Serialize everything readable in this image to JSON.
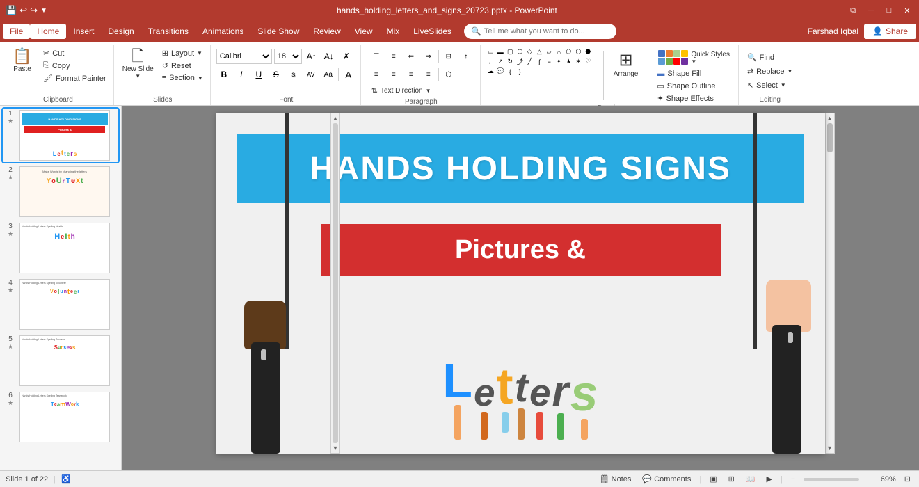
{
  "titlebar": {
    "title": "hands_holding_letters_and_signs_20723.pptx - PowerPoint",
    "quickaccess": [
      "💾",
      "↩",
      "↪",
      "📋",
      "▼"
    ]
  },
  "menubar": {
    "items": [
      "File",
      "Home",
      "Insert",
      "Design",
      "Transitions",
      "Animations",
      "Slide Show",
      "Review",
      "View",
      "Mix",
      "LiveSlides"
    ],
    "active": "Home",
    "search_placeholder": "Tell me what you want to do...",
    "user": "Farshad Iqbal",
    "share_label": "Share"
  },
  "ribbon": {
    "groups": {
      "clipboard": {
        "label": "Clipboard",
        "paste_label": "Paste",
        "cut_label": "Cut",
        "copy_label": "Copy",
        "format_painter_label": "Format Painter"
      },
      "slides": {
        "label": "Slides",
        "new_slide_label": "New Slide",
        "layout_label": "Layout",
        "reset_label": "Reset",
        "section_label": "Section"
      },
      "font": {
        "label": "Font",
        "font_name": "Calibri",
        "font_size": "18",
        "bold": "B",
        "italic": "I",
        "underline": "U",
        "strikethrough": "S",
        "shadow": "s",
        "char_spacing": "AV",
        "case": "Aa",
        "font_color": "A"
      },
      "paragraph": {
        "label": "Paragraph",
        "text_direction_label": "Text Direction",
        "align_text_label": "Align Text",
        "convert_smartart_label": "Convert to SmartArt"
      },
      "drawing": {
        "label": "Drawing",
        "arrange_label": "Arrange",
        "quick_styles_label": "Quick Styles",
        "shape_fill_label": "Shape Fill",
        "shape_outline_label": "Shape Outline",
        "shape_effects_label": "Shape Effects"
      },
      "editing": {
        "label": "Editing",
        "find_label": "Find",
        "replace_label": "Replace",
        "select_label": "Select"
      }
    }
  },
  "slides": [
    {
      "num": "1",
      "starred": true,
      "active": true,
      "title": "HANDS HOLDING SIGNS",
      "subtitle": "Pictures & Letters"
    },
    {
      "num": "2",
      "starred": true,
      "title": "Make Words by changing the letters",
      "subtitle": "YoUr TeXt"
    },
    {
      "num": "3",
      "starred": true,
      "title": "Hands Holding Letters Spelling Health",
      "subtitle": "HeIth"
    },
    {
      "num": "4",
      "starred": true,
      "title": "Hands Holding Letters Spelling Volunteer",
      "subtitle": "Volunteer"
    },
    {
      "num": "5",
      "starred": true,
      "title": "Hands Holding Letters Spelling Success",
      "subtitle": "Success"
    },
    {
      "num": "6",
      "starred": true,
      "title": "Hands Holding Letters Spelling Teamwork",
      "subtitle": "TeamWork"
    }
  ],
  "main_slide": {
    "title": "HANDS HOLDING SIGNS",
    "subtitle": "Pictures &",
    "letters": "Letters"
  },
  "statusbar": {
    "slide_info": "Slide 1 of 22",
    "notes_label": "Notes",
    "comments_label": "Comments",
    "zoom": "69%",
    "fit_label": "⊞"
  }
}
